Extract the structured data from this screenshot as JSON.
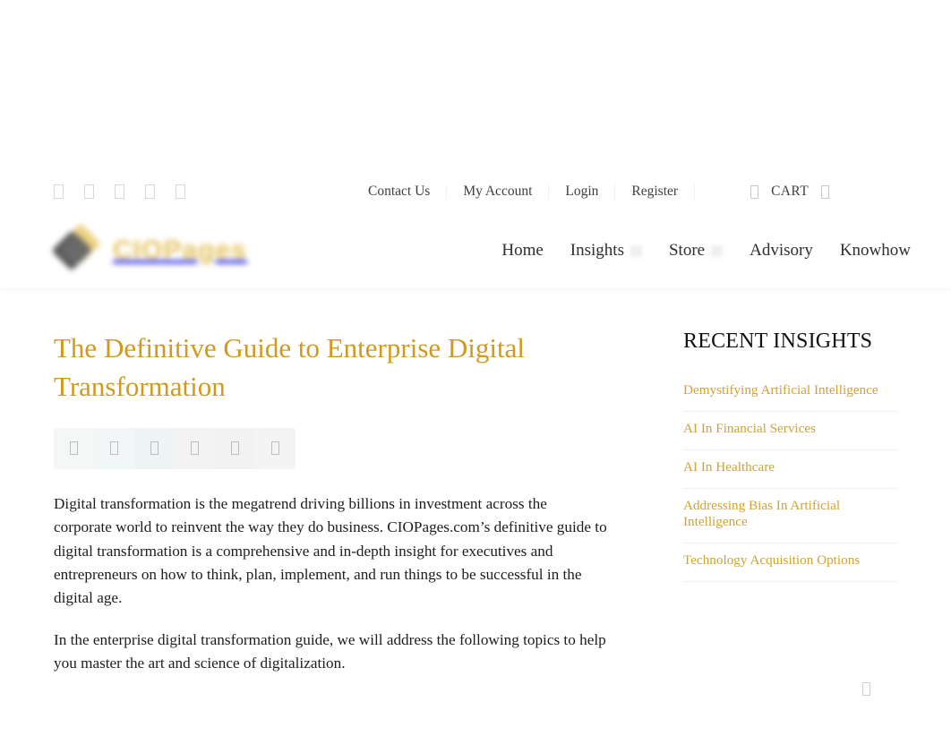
{
  "site": {
    "logo_text": "CIOPages",
    "logo_mark_icon": "diamond-logo-icon"
  },
  "utility_bar": {
    "social_icons": [
      {
        "name": "facebook-icon",
        "glyph": ""
      },
      {
        "name": "twitter-icon",
        "glyph": ""
      },
      {
        "name": "linkedin-icon",
        "glyph": ""
      },
      {
        "name": "youtube-icon",
        "glyph": ""
      },
      {
        "name": "rss-icon",
        "glyph": ""
      }
    ],
    "links": [
      {
        "label": "Contact Us"
      },
      {
        "label": "My Account"
      },
      {
        "label": "Login"
      },
      {
        "label": "Register"
      }
    ],
    "cart": {
      "icon": "cart-icon",
      "label": "CART",
      "caret_icon": "chevron-down-icon"
    }
  },
  "main_nav": {
    "items": [
      {
        "label": "Home",
        "has_dropdown": false
      },
      {
        "label": "Insights",
        "has_dropdown": true
      },
      {
        "label": "Store",
        "has_dropdown": true
      },
      {
        "label": "Advisory",
        "has_dropdown": false
      },
      {
        "label": "Knowhow",
        "has_dropdown": false
      }
    ]
  },
  "article": {
    "title": "The Definitive Guide to Enterprise Digital Transformation",
    "title_color": "#d19a1c",
    "share_buttons": [
      {
        "name": "share-facebook-button",
        "icon": "facebook-icon"
      },
      {
        "name": "share-twitter-button",
        "icon": "twitter-icon"
      },
      {
        "name": "share-linkedin-button",
        "icon": "linkedin-icon"
      },
      {
        "name": "share-pinterest-button",
        "icon": "pinterest-icon"
      },
      {
        "name": "share-email-button",
        "icon": "email-icon"
      },
      {
        "name": "share-print-button",
        "icon": "print-icon"
      }
    ],
    "paragraphs": [
      "Digital transformation is the megatrend driving billions in investment across the corporate world to reinvent the way they do business. CIOPages.com’s definitive guide to digital transformation is a comprehensive and in-depth insight for executives and entrepreneurs on how to think, plan, implement, and run things to be successful in the digital age.",
      "In the enterprise digital transformation guide, we will address the following topics to help you master the art and science of digitalization."
    ]
  },
  "sidebar": {
    "title": "RECENT INSIGHTS",
    "link_color": "#cfa32e",
    "items": [
      {
        "label": "Demystifying Artificial Intelligence"
      },
      {
        "label": "AI In Financial Services"
      },
      {
        "label": "AI In Healthcare"
      },
      {
        "label": "Addressing Bias In Artificial Intelligence"
      },
      {
        "label": "Technology Acquisition Options"
      }
    ]
  },
  "back_to_top": {
    "icon": "chevron-up-icon"
  }
}
